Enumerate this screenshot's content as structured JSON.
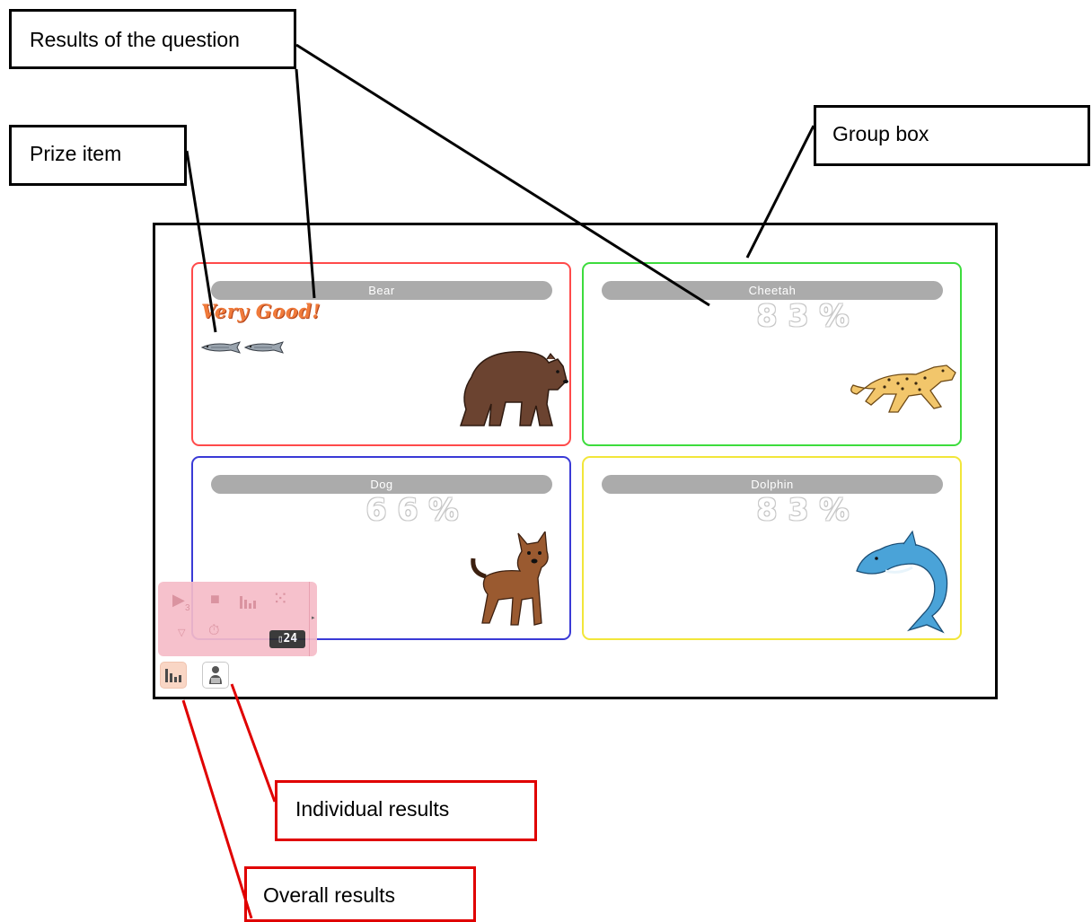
{
  "callouts": {
    "results_of_question": "Results of the question",
    "prize_item": "Prize item",
    "group_box": "Group box",
    "individual_results": "Individual results",
    "overall_results": "Overall results"
  },
  "groups": [
    {
      "name": "Bear",
      "result_text": "Very Good!",
      "prize_count": 2,
      "border_color": "#ff4a4a"
    },
    {
      "name": "Cheetah",
      "percent": "83%",
      "border_color": "#3ddc3d"
    },
    {
      "name": "Dog",
      "percent": "66%",
      "border_color": "#3a3ad6"
    },
    {
      "name": "Dolphin",
      "percent": "83%",
      "border_color": "#f2e63a"
    }
  ],
  "toolbar": {
    "play_sub": "3",
    "counter_value": "24",
    "accent_color": "#f6bcc8"
  },
  "icons": [
    "play-icon",
    "stop-icon",
    "bar-chart-icon",
    "loading-icon",
    "expand-icon",
    "timer-icon",
    "counter-icon",
    "arrow-right-icon",
    "person-icon"
  ]
}
